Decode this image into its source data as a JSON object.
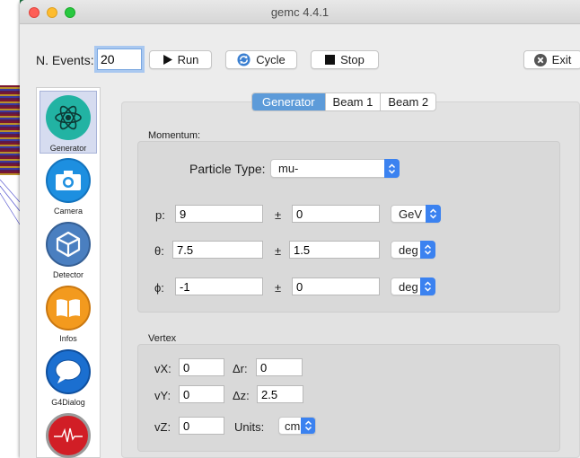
{
  "window": {
    "title": "gemc 4.4.1"
  },
  "toolbar": {
    "events_label": "N. Events:",
    "events_value": "20",
    "run_label": "Run",
    "cycle_label": "Cycle",
    "stop_label": "Stop",
    "exit_label": "Exit"
  },
  "sidebar": {
    "items": [
      {
        "label": "Generator",
        "icon": "atom-icon",
        "selected": true
      },
      {
        "label": "Camera",
        "icon": "camera-icon"
      },
      {
        "label": "Detector",
        "icon": "unity-cube-icon"
      },
      {
        "label": "Infos",
        "icon": "book-icon"
      },
      {
        "label": "G4Dialog",
        "icon": "chat-bubble-icon"
      },
      {
        "label": "",
        "icon": "heartbeat-icon"
      }
    ]
  },
  "tabs": [
    {
      "label": "Generator",
      "active": true
    },
    {
      "label": "Beam 1"
    },
    {
      "label": "Beam 2"
    }
  ],
  "momentum": {
    "title": "Momentum:",
    "particle_label": "Particle Type:",
    "particle_value": "mu-",
    "pm": "±",
    "p_label": "p:",
    "p_value": "9",
    "p_err": "0",
    "p_unit": "GeV",
    "theta_label": "θ:",
    "theta_value": "7.5",
    "theta_err": "1.5",
    "theta_unit": "deg",
    "phi_label": "ϕ:",
    "phi_value": "-1",
    "phi_err": "0",
    "phi_unit": "deg"
  },
  "vertex": {
    "title": "Vertex",
    "vx_label": "vX:",
    "vx_value": "0",
    "vy_label": "vY:",
    "vy_value": "0",
    "vz_label": "vZ:",
    "vz_value": "0",
    "dr_label": "Δr:",
    "dr_value": "0",
    "dz_label": "Δz:",
    "dz_value": "2.5",
    "units_label": "Units:",
    "units_value": "cm"
  },
  "colors": {
    "accent": "#3b82f0",
    "tab_active": "#5d9bd9"
  }
}
